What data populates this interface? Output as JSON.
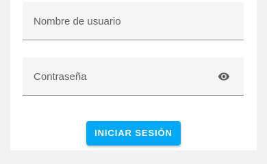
{
  "form": {
    "username": {
      "placeholder": "Nombre de usuario",
      "value": ""
    },
    "password": {
      "placeholder": "Contraseña",
      "value": "",
      "toggle_icon": "eye-icon"
    },
    "submit_label": "INICIAR SESIÓN"
  },
  "colors": {
    "accent": "#03a9f4",
    "field_background": "#f5f5f5",
    "page_background": "#f2f2f2",
    "label_text": "#5f5f5f",
    "icon": "#5f5f5f"
  }
}
